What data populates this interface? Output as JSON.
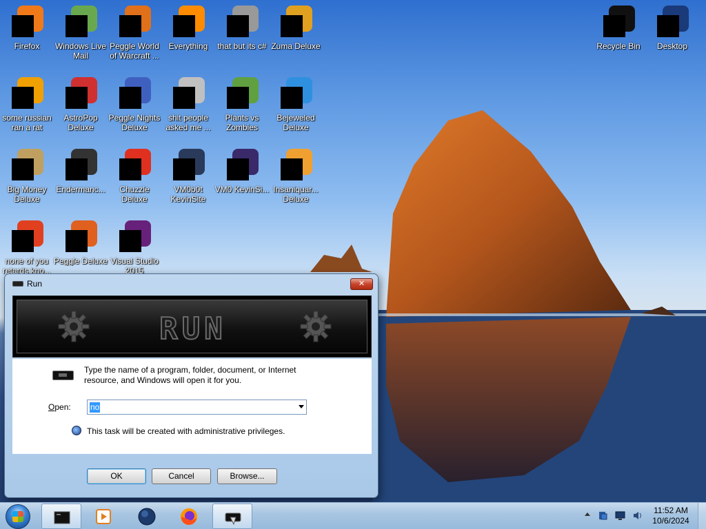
{
  "desktop": {
    "icons_left": [
      {
        "label": "Firefox",
        "name": "firefox",
        "color": "#f07a1a"
      },
      {
        "label": "Windows Live Mail",
        "name": "windows-live-mail",
        "color": "#6aa84f"
      },
      {
        "label": "Peggle World of Warcraft ...",
        "name": "peggle-wow",
        "color": "#e0701a"
      },
      {
        "label": "Everything",
        "name": "everything",
        "color": "#ff8c00"
      },
      {
        "label": "that but its c#",
        "name": "that-but-its-csharp",
        "color": "#999999"
      },
      {
        "label": "Zuma Deluxe",
        "name": "zuma-deluxe",
        "color": "#e0a020"
      },
      {
        "label": "some russian ran a rat",
        "name": "some-russian-ran-a-rat",
        "color": "#f0a000"
      },
      {
        "label": "AstroPop Deluxe",
        "name": "astropop-deluxe",
        "color": "#d03030"
      },
      {
        "label": "Peggle Nights Deluxe",
        "name": "peggle-nights-deluxe",
        "color": "#4060c0"
      },
      {
        "label": "shit people asked me ...",
        "name": "shit-people-asked-me",
        "color": "#c0c0c0"
      },
      {
        "label": "Plants vs Zombies",
        "name": "plants-vs-zombies",
        "color": "#60a040"
      },
      {
        "label": "Bejeweled Deluxe",
        "name": "bejeweled-deluxe",
        "color": "#3090e0"
      },
      {
        "label": "Big Money Deluxe",
        "name": "big-money-deluxe",
        "color": "#c0a060"
      },
      {
        "label": "Endermanc...",
        "name": "endermanch",
        "color": "#333333"
      },
      {
        "label": "Chuzzle Deluxe",
        "name": "chuzzle-deluxe",
        "color": "#e03020"
      },
      {
        "label": "VM0b0t KevinSite",
        "name": "vm0b0t-kevinsite",
        "color": "#2a3a5a"
      },
      {
        "label": "VM0 KevinSi...",
        "name": "vm0-kevinsite",
        "color": "#3a2a6a"
      },
      {
        "label": "Insaniquar... Deluxe",
        "name": "insaniquarium-deluxe",
        "color": "#f0a030"
      },
      {
        "label": "none of you retards kno...",
        "name": "none-of-you",
        "color": "#e04020"
      },
      {
        "label": "Peggle Deluxe",
        "name": "peggle-deluxe",
        "color": "#e06020"
      },
      {
        "label": "Visual Studio 2015",
        "name": "visual-studio-2015",
        "color": "#68217a"
      }
    ],
    "icons_right": [
      {
        "label": "Recycle Bin",
        "name": "recycle-bin",
        "color": "#111111"
      },
      {
        "label": "Desktop",
        "name": "desktop",
        "color": "#1a3a7a"
      }
    ]
  },
  "dialog": {
    "title": "Run",
    "close_label": "✕",
    "banner_title": "RUN",
    "description": "Type the name of a program, folder, document, or Internet resource, and Windows will open it for you.",
    "open_label_hotkey": "O",
    "open_label_rest": "pen:",
    "open_value": "no",
    "admin_note": "This task will be created with administrative privileges.",
    "buttons": {
      "ok": "OK",
      "cancel": "Cancel",
      "browse": "Browse..."
    }
  },
  "taskbar": {
    "clock_time": "11:52 AM",
    "clock_date": "10/6/2024"
  }
}
